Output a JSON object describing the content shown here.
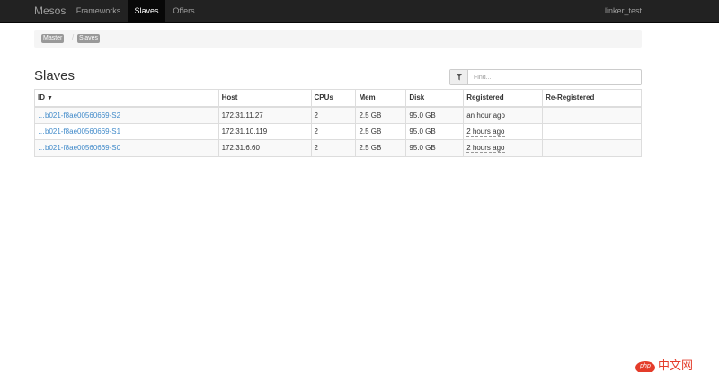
{
  "nav": {
    "brand": "Mesos",
    "items": [
      {
        "label": "Frameworks"
      },
      {
        "label": "Slaves"
      },
      {
        "label": "Offers"
      }
    ],
    "user": "linker_test"
  },
  "breadcrumb": [
    "Master",
    "Slaves"
  ],
  "page_title": "Slaves",
  "filter": {
    "placeholder": "Find..."
  },
  "table": {
    "headers": [
      "ID",
      "Host",
      "CPUs",
      "Mem",
      "Disk",
      "Registered",
      "Re-Registered"
    ],
    "sort_indicator": "▼",
    "rows": [
      {
        "id": "…b021-f8ae00560669-S2",
        "host": "172.31.11.27",
        "cpus": "2",
        "mem": "2.5 GB",
        "disk": "95.0 GB",
        "registered": "an hour ago",
        "reregistered": ""
      },
      {
        "id": "…b021-f8ae00560669-S1",
        "host": "172.31.10.119",
        "cpus": "2",
        "mem": "2.5 GB",
        "disk": "95.0 GB",
        "registered": "2 hours ago",
        "reregistered": ""
      },
      {
        "id": "…b021-f8ae00560669-S0",
        "host": "172.31.6.60",
        "cpus": "2",
        "mem": "2.5 GB",
        "disk": "95.0 GB",
        "registered": "2 hours ago",
        "reregistered": ""
      }
    ]
  },
  "watermark": {
    "logo": "php",
    "text": "中文网"
  },
  "colors": {
    "navbar": "#222222",
    "link": "#428bca",
    "watermark": "#e43c2a"
  }
}
